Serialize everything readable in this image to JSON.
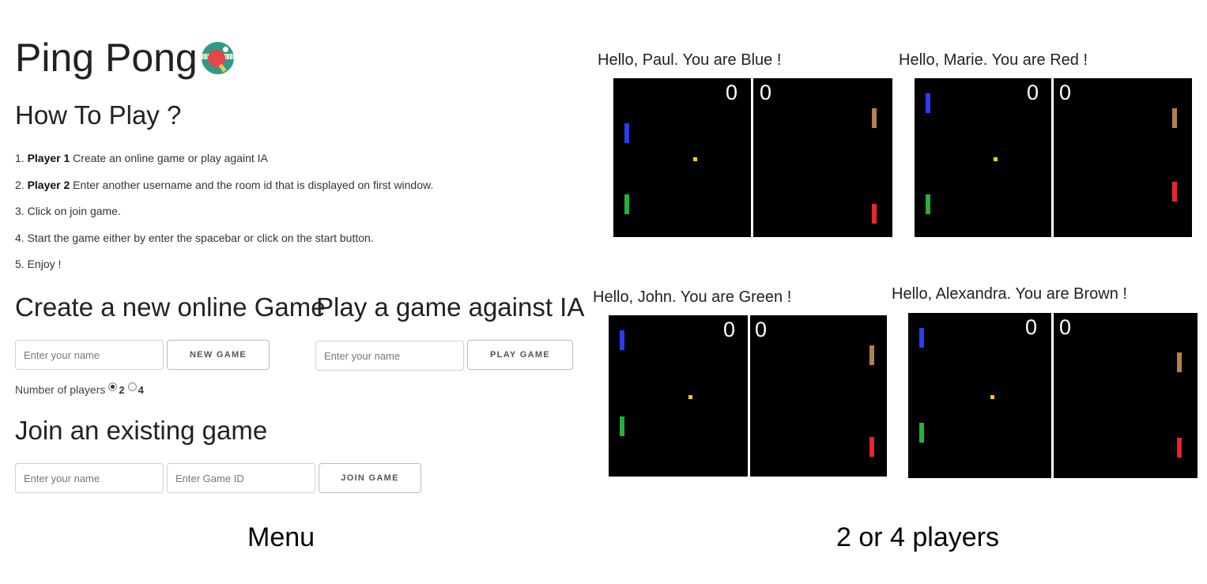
{
  "menu": {
    "title": "Ping Pong",
    "how_to_play": "How To Play ?",
    "steps": [
      {
        "num": "1.",
        "bold": "Player 1",
        "text": " Create an online game or play againt IA"
      },
      {
        "num": "2.",
        "bold": "Player 2",
        "text": " Enter another username and the room id that is displayed on first window."
      },
      {
        "num": "3.",
        "bold": "",
        "text": "Click on join game."
      },
      {
        "num": "4.",
        "bold": "",
        "text": "Start the game either by enter the spacebar or click on the start button."
      },
      {
        "num": "5.",
        "bold": "",
        "text": "Enjoy !"
      }
    ],
    "create_heading": "Create a new online Game",
    "ia_heading": "Play a game against IA",
    "join_heading": "Join an existing game",
    "name_placeholder": "Enter your name",
    "game_id_placeholder": "Enter Game ID",
    "new_game_label": "NEW GAME",
    "play_game_label": "PLAY GAME",
    "join_game_label": "JOIN GAME",
    "players_label": "Number of players",
    "players_options": [
      "2",
      "4"
    ],
    "players_selected": "2"
  },
  "captions": {
    "left": "Menu",
    "right": "2 or 4 players"
  },
  "colors": {
    "blue": "#2b3cf0",
    "red": "#e8262c",
    "green": "#25b13a",
    "brown": "#b4804e",
    "ball": "#ffcc00"
  },
  "boards": [
    {
      "title": "Hello, Paul. You are Blue !",
      "score_left": "0",
      "score_right": "0"
    },
    {
      "title": "Hello, Marie. You are Red !",
      "score_left": "0",
      "score_right": "0"
    },
    {
      "title": "Hello, John. You are Green !",
      "score_left": "0",
      "score_right": "0"
    },
    {
      "title": "Hello, Alexandra. You are Brown !",
      "score_left": "0",
      "score_right": "0"
    }
  ]
}
